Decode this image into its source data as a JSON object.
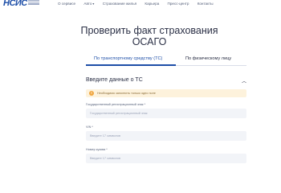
{
  "header": {
    "logo_text": "НСИС",
    "nav": [
      {
        "label": "О сервисе",
        "has_dropdown": false
      },
      {
        "label": "Авто",
        "has_dropdown": true
      },
      {
        "label": "Страхование жилья",
        "has_dropdown": false
      },
      {
        "label": "Карьера",
        "has_dropdown": false
      },
      {
        "label": "Пресс-центр",
        "has_dropdown": false
      },
      {
        "label": "Контакты",
        "has_dropdown": false
      }
    ]
  },
  "main": {
    "title_line1": "Проверить факт страхования",
    "title_line2": "ОСАГО",
    "tabs": [
      {
        "label": "По транспортному средству (ТС)",
        "active": true
      },
      {
        "label": "По физическому лицу",
        "active": false
      }
    ]
  },
  "form": {
    "section_title": "Введите данные о ТС",
    "note": "Необходимо заполнить только одно поле",
    "fields": [
      {
        "label": "Государственный регистрационный знак *",
        "placeholder": "Государственный регистрационный знак"
      },
      {
        "label": "VIN *",
        "placeholder": "Введите 17 символов"
      },
      {
        "label": "Номер кузова *",
        "placeholder": "Введите 17 символов"
      }
    ]
  },
  "colors": {
    "accent": "#1e4fa8",
    "note_bg": "#fdf2dc",
    "field_bg": "#f2f4f8"
  },
  "icons": {
    "chevron": "chevron-up-icon",
    "note": "info-icon",
    "dropdown": "chevron-down-icon"
  }
}
